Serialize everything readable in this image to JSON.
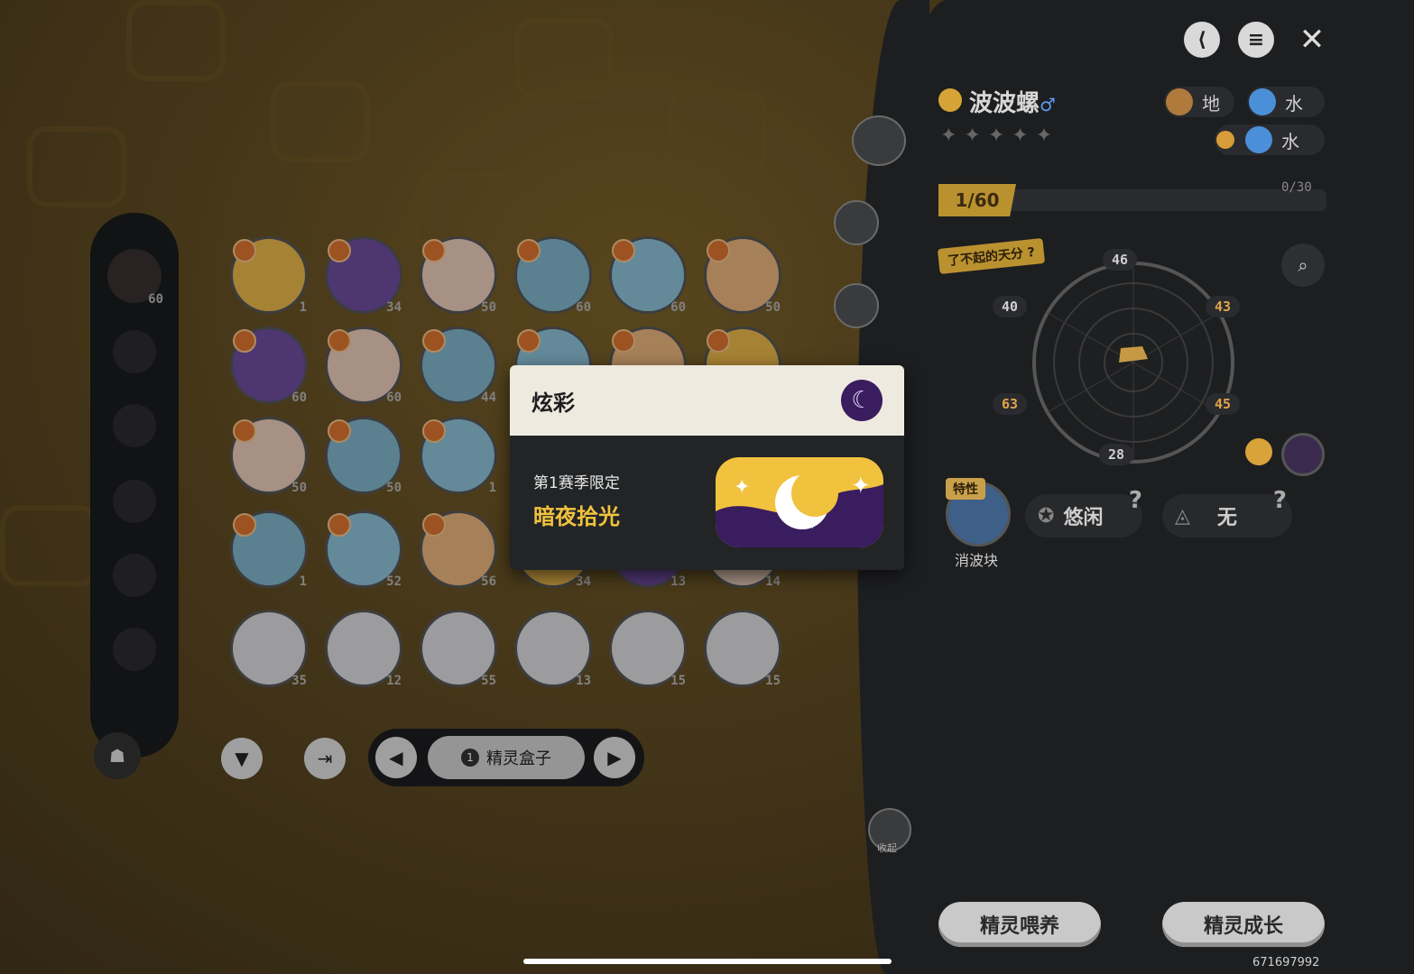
{
  "background": {
    "color": "#5e4a22"
  },
  "sidebar": {
    "top_level": "60"
  },
  "grid": {
    "rows": [
      [
        {
          "lv": "1"
        },
        {
          "lv": "34"
        },
        {
          "lv": "50"
        },
        {
          "lv": "60"
        },
        {
          "lv": "60"
        },
        {
          "lv": "50"
        }
      ],
      [
        {
          "lv": "60"
        },
        {
          "lv": "60"
        },
        {
          "lv": "44"
        },
        {
          "lv": ""
        },
        {
          "lv": ""
        },
        {
          "lv": ""
        }
      ],
      [
        {
          "lv": "50"
        },
        {
          "lv": "50"
        },
        {
          "lv": "1"
        },
        {
          "lv": ""
        },
        {
          "lv": ""
        },
        {
          "lv": ""
        }
      ],
      [
        {
          "lv": "1"
        },
        {
          "lv": "52"
        },
        {
          "lv": "56"
        },
        {
          "lv": "34"
        },
        {
          "lv": "13"
        },
        {
          "lv": "14"
        }
      ],
      [
        {
          "lv": "35"
        },
        {
          "lv": "12"
        },
        {
          "lv": "55"
        },
        {
          "lv": "13"
        },
        {
          "lv": "15"
        },
        {
          "lv": "15"
        }
      ]
    ]
  },
  "pager": {
    "box_label": "精灵盒子",
    "box_count": "1"
  },
  "modal": {
    "title": "炫彩",
    "season": "第1赛季限定",
    "skin_name": "暗夜拾光"
  },
  "pet": {
    "name": "波波螺",
    "gender": "♂",
    "attr1": "地",
    "attr2": "水",
    "attr3": "水",
    "level": "1/60",
    "xp": "0/30",
    "talent": "了不起的天分",
    "stats": {
      "top": "46",
      "left_top": "40",
      "right_top": "43",
      "left_bottom": "63",
      "right_bottom": "45",
      "bottom": "28"
    },
    "trait_label": "特性",
    "trait_name": "消波块",
    "nature": "悠闲",
    "item": "无"
  },
  "collapse_label": "收起",
  "buttons": {
    "feed": "精灵喂养",
    "grow": "精灵成长"
  },
  "uid": "671697992",
  "colors": {
    "accent_gold": "#f1c23d",
    "skin_purple": "#3a1d5e",
    "panel": "#1d1e20"
  }
}
